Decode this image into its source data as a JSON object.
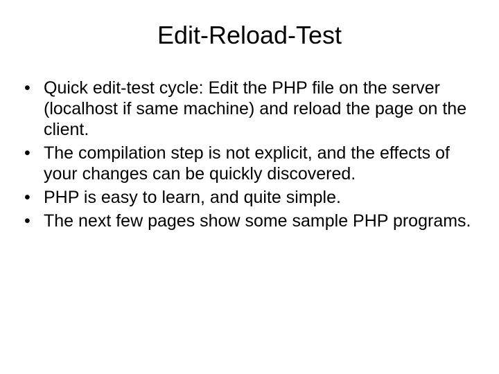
{
  "slide": {
    "title": "Edit-Reload-Test",
    "bullets": [
      "Quick edit-test cycle: Edit the PHP file on the server (localhost if same machine) and reload the page on the client.",
      "The compilation step is not explicit, and the effects of your changes can be quickly discovered.",
      "PHP is easy to learn, and quite simple.",
      "The next few pages show some sample PHP programs."
    ]
  }
}
